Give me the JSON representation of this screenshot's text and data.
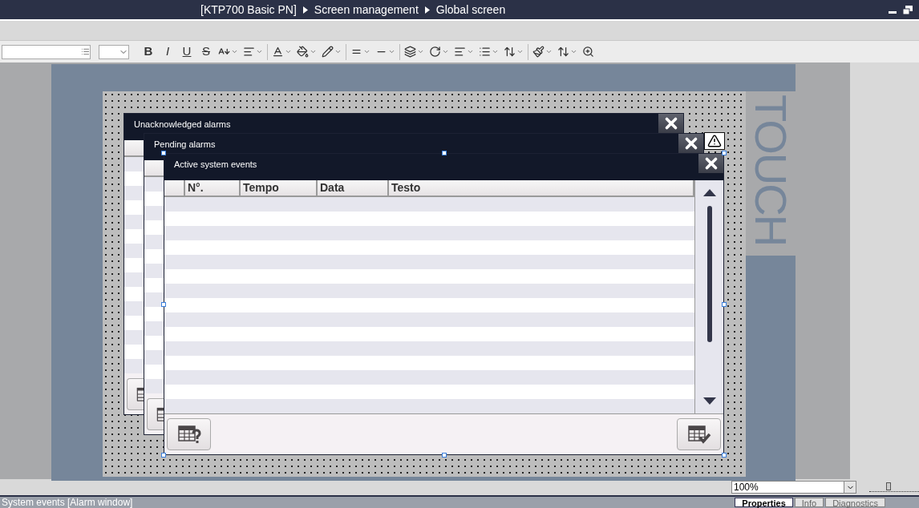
{
  "title_bar": {
    "breadcrumb": [
      "[KTP700 Basic PN]",
      "Screen management",
      "Global screen"
    ]
  },
  "format_toolbar": {
    "style_buttons": [
      {
        "kind": "bold",
        "label": "B"
      },
      {
        "kind": "italic",
        "label": "I"
      },
      {
        "kind": "underline",
        "label": "U"
      },
      {
        "kind": "strike",
        "label": "S"
      }
    ]
  },
  "device": {
    "brand_label": "TOUCH"
  },
  "alarm_windows": [
    {
      "title": "Unacknowledged alarms",
      "selected": false
    },
    {
      "title": "Pending alarms",
      "selected": false
    },
    {
      "title": "Active system events",
      "selected": true,
      "columns": [
        "N°.",
        "Tempo",
        "Data",
        "Testo"
      ]
    }
  ],
  "zoom": {
    "value": "100%",
    "level": 0.38
  },
  "inspector": {
    "title": "System events [Alarm window]",
    "tabs": [
      {
        "label": "Properties",
        "selected": true
      },
      {
        "label": "Info",
        "selected": false
      },
      {
        "label": "Diagnostics",
        "selected": false
      }
    ]
  }
}
